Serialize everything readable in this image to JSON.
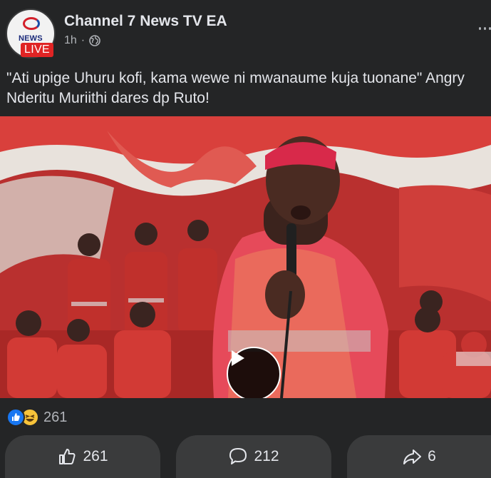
{
  "header": {
    "page_name": "Channel 7 News TV EA",
    "time": "1h",
    "separator": "·",
    "avatar": {
      "logo_text": "NEWS",
      "live_badge": "LIVE"
    }
  },
  "post": {
    "caption": "\"Ati upige Uhuru kofi, kama wewe ni mwanaume kuja tuonane\" Angry Nderitu Muriithi dares dp Ruto!"
  },
  "reactions": {
    "icons": [
      "like-icon",
      "haha-icon"
    ],
    "count": "261"
  },
  "actions": {
    "like_count": "261",
    "comment_count": "212",
    "share_count": "6"
  },
  "colors": {
    "background": "#242526",
    "button_bg": "#3a3b3c",
    "text": "#e4e6eb",
    "muted_text": "#b0b3b8",
    "live_red": "#e02424",
    "like_blue": "#1877f2"
  }
}
